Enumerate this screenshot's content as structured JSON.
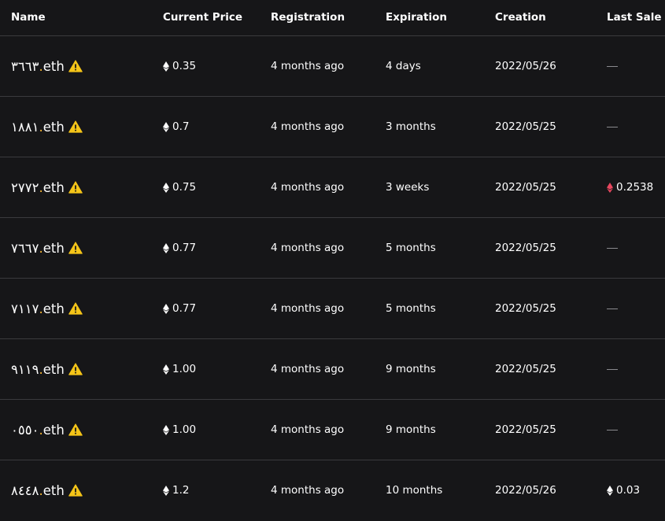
{
  "columns": {
    "name": "Name",
    "price": "Current Price",
    "registration": "Registration",
    "expiration": "Expiration",
    "creation": "Creation",
    "last_sale": "Last Sale"
  },
  "colors": {
    "background": "#161618",
    "divider": "#3a3a3d",
    "dot_accent": "#f5b532",
    "warning": "#f5c518",
    "sale_red": "#e8475f"
  },
  "rows": [
    {
      "digits": "٣٦٦٣",
      "dot": ".",
      "suffix": "eth",
      "price": "0.35",
      "registration": "4 months ago",
      "expiration": "4 days",
      "creation": "2022/05/26",
      "last_sale": "—",
      "sale_color": ""
    },
    {
      "digits": "١٨٨١",
      "dot": ".",
      "suffix": "eth",
      "price": "0.7",
      "registration": "4 months ago",
      "expiration": "3 months",
      "creation": "2022/05/25",
      "last_sale": "—",
      "sale_color": ""
    },
    {
      "digits": "٢٧٧٢",
      "dot": ".",
      "suffix": "eth",
      "price": "0.75",
      "registration": "4 months ago",
      "expiration": "3 weeks",
      "creation": "2022/05/25",
      "last_sale": "0.2538",
      "sale_color": "red"
    },
    {
      "digits": "٧٦٦٧",
      "dot": ".",
      "suffix": "eth",
      "price": "0.77",
      "registration": "4 months ago",
      "expiration": "5 months",
      "creation": "2022/05/25",
      "last_sale": "—",
      "sale_color": ""
    },
    {
      "digits": "٧١١٧",
      "dot": ".",
      "suffix": "eth",
      "price": "0.77",
      "registration": "4 months ago",
      "expiration": "5 months",
      "creation": "2022/05/25",
      "last_sale": "—",
      "sale_color": ""
    },
    {
      "digits": "٩١١٩",
      "dot": ".",
      "suffix": "eth",
      "price": "1.00",
      "registration": "4 months ago",
      "expiration": "9 months",
      "creation": "2022/05/25",
      "last_sale": "—",
      "sale_color": ""
    },
    {
      "digits": "٠٥٥٠",
      "dot": ".",
      "suffix": "eth",
      "price": "1.00",
      "registration": "4 months ago",
      "expiration": "9 months",
      "creation": "2022/05/25",
      "last_sale": "—",
      "sale_color": ""
    },
    {
      "digits": "٨٤٤٨",
      "dot": ".",
      "suffix": "eth",
      "price": "1.2",
      "registration": "4 months ago",
      "expiration": "10 months",
      "creation": "2022/05/26",
      "last_sale": "0.03",
      "sale_color": "white"
    }
  ]
}
